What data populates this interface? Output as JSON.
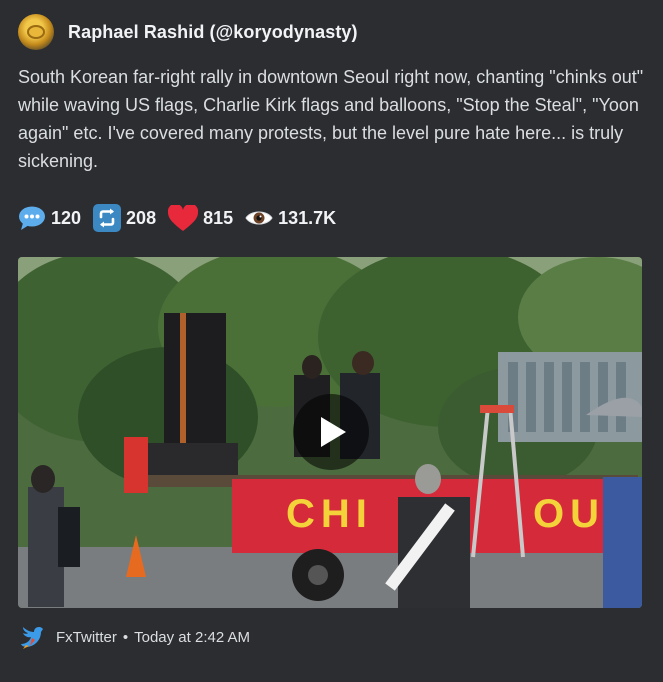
{
  "author": {
    "name": "Raphael Rashid (@koryodynasty)"
  },
  "post": {
    "text": "South Korean far-right rally in downtown Seoul right now, chanting \"chinks out\" while waving US flags, Charlie Kirk flags and balloons, \"Stop the Steal\", \"Yoon again\" etc. I've covered many protests, but the level pure hate here... is truly sickening."
  },
  "stats": {
    "replies": "120",
    "retweets": "208",
    "likes": "815",
    "views": "131.7K"
  },
  "media": {
    "banner_text": "CHINA OUT",
    "play_icon": "play-icon"
  },
  "footer": {
    "source": "FxTwitter",
    "separator": "•",
    "timestamp": "Today at 2:42 AM"
  },
  "colors": {
    "background": "#2b2d31",
    "banner_red": "#d52a3a",
    "banner_text": "#f3d23a",
    "heart": "#e8283b",
    "retweet": "#3b88c3",
    "reply": "#5dadec"
  }
}
